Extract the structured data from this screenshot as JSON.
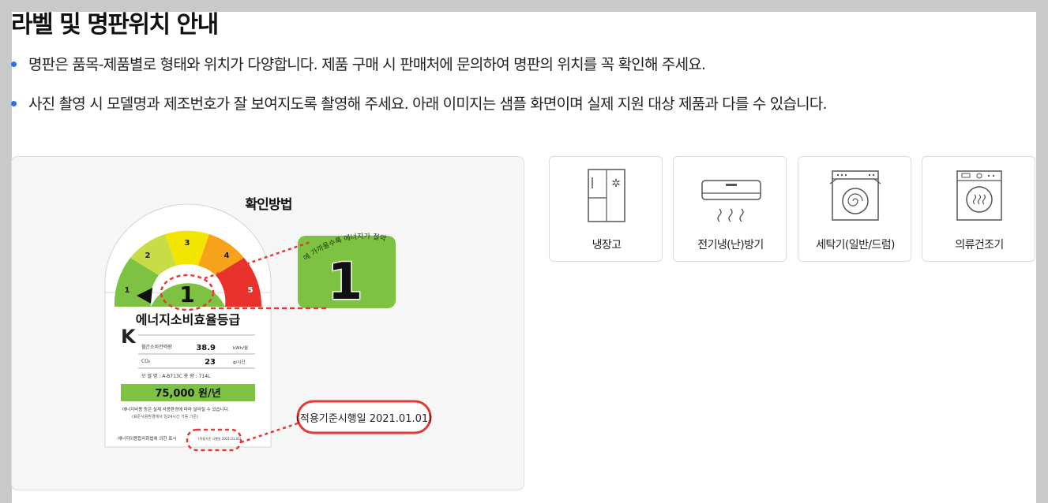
{
  "page": {
    "title": "라벨 및 명판위치 안내",
    "bullets": [
      "명판은 품목-제품별로 형태와 위치가 다양합니다. 제품 구매 시 판매처에 문의하여 명판의 위치를 꼭 확인해 주세요.",
      "사진 촬영 시 모델명과 제조번호가 잘 보여지도록 촬영해 주세요. 아래 이미지는 샘플 화면이며 실제 지원 대상 제품과 다를 수 있습니다."
    ]
  },
  "guide": {
    "title": "확인방법",
    "label": {
      "grade_numbers": [
        "1",
        "2",
        "3",
        "4",
        "5"
      ],
      "current_grade": "1",
      "zoom_arc_text": "에 가까울수록 에너지가 절약",
      "heading": "에너지소비효율등급",
      "row1_label": "월간소비전력량",
      "row1_value": "38.9",
      "row1_unit": "kWh/월",
      "row2_label": "CO₂",
      "row2_value": "23",
      "row2_unit": "g/시간",
      "model_line": "모 델 명 : A-B713C     용    량 : 714L",
      "cost": "75,000 원/년",
      "note1": "에너지비용 등은 실제 사용환경에 따라 달라질 수 있습니다.",
      "note2": "(표준사용환경에서 일24시간 가동 기준)",
      "footer": "에너지이용합리화법에 의한 표시",
      "footer_small": "(적용기준 시행일 2021.01.01)",
      "callout_date": "(적용기준시행일 2021.01.01)"
    },
    "colors": {
      "grade1": "#7dc242",
      "grade2": "#c7dc45",
      "grade3": "#f2e500",
      "grade4": "#f7a21b",
      "grade5": "#e8312a",
      "highlight_red": "#e53935",
      "bullet_blue": "#2f6fe0"
    }
  },
  "categories": [
    {
      "label": "냉장고",
      "icon": "refrigerator-icon"
    },
    {
      "label": "전기냉(난)방기",
      "icon": "air-conditioner-icon"
    },
    {
      "label": "세탁기(일반/드럼)",
      "icon": "washing-machine-icon"
    },
    {
      "label": "의류건조기",
      "icon": "clothes-dryer-icon"
    }
  ]
}
